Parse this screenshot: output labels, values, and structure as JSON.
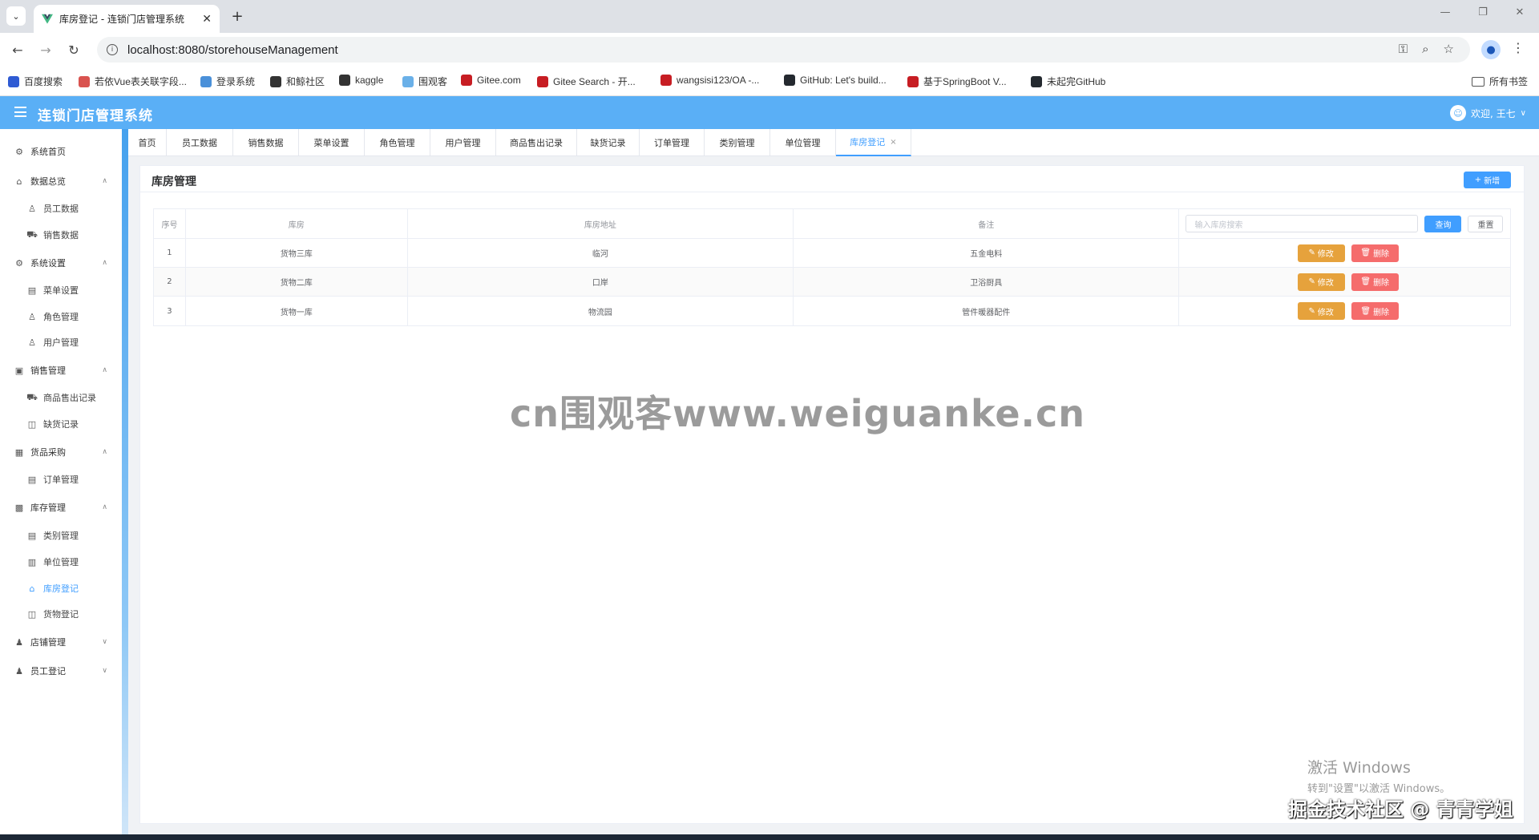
{
  "browser": {
    "tab_title": "库房登记 - 连锁门店管理系统",
    "url": "localhost:8080/storehouseManagement",
    "bookmarks": [
      {
        "label": "百度搜索",
        "color": "#2f5bd3"
      },
      {
        "label": "若依Vue表关联字段...",
        "color": "#d9534f"
      },
      {
        "label": "登录系统",
        "color": "#4a90d9"
      },
      {
        "label": "和鲸社区",
        "color": "#333333"
      },
      {
        "label": "kaggle",
        "color": "#333333"
      },
      {
        "label": "围观客",
        "color": "#6ab0e8"
      },
      {
        "label": "Gitee.com",
        "color": "#c71d23"
      },
      {
        "label": "Gitee Search - 开...",
        "color": "#c71d23"
      },
      {
        "label": "wangsisi123/OA -...",
        "color": "#c71d23"
      },
      {
        "label": "GitHub: Let's build...",
        "color": "#24292f"
      },
      {
        "label": "基于SpringBoot V...",
        "color": "#c71d23"
      },
      {
        "label": "未起完GitHub",
        "color": "#24292f"
      }
    ],
    "all_bookmarks": "所有书签"
  },
  "header": {
    "title": "连锁门店管理系统",
    "user": "欢迎, 王七"
  },
  "sidebar": {
    "items": [
      {
        "label": "系统首页",
        "type": "top",
        "icon": "settings-icon"
      },
      {
        "label": "数据总览",
        "type": "top",
        "icon": "home-icon",
        "chevron": "up"
      },
      {
        "label": "员工数据",
        "type": "sub",
        "icon": "user-icon"
      },
      {
        "label": "销售数据",
        "type": "sub",
        "icon": "truck-icon"
      },
      {
        "label": "系统设置",
        "type": "top",
        "icon": "gear-icon",
        "chevron": "up"
      },
      {
        "label": "菜单设置",
        "type": "sub",
        "icon": "document-icon"
      },
      {
        "label": "角色管理",
        "type": "sub",
        "icon": "user-icon"
      },
      {
        "label": "用户管理",
        "type": "sub",
        "icon": "user-icon"
      },
      {
        "label": "销售管理",
        "type": "top",
        "icon": "picture-icon",
        "chevron": "up"
      },
      {
        "label": "商品售出记录",
        "type": "sub",
        "icon": "truck-icon"
      },
      {
        "label": "缺货记录",
        "type": "sub",
        "icon": "bag-icon"
      },
      {
        "label": "货品采购",
        "type": "top",
        "icon": "lock-icon",
        "chevron": "up"
      },
      {
        "label": "订单管理",
        "type": "sub",
        "icon": "document-icon"
      },
      {
        "label": "库存管理",
        "type": "top",
        "icon": "briefcase-icon",
        "chevron": "up"
      },
      {
        "label": "类别管理",
        "type": "sub",
        "icon": "document-icon"
      },
      {
        "label": "单位管理",
        "type": "sub",
        "icon": "office-icon"
      },
      {
        "label": "库房登记",
        "type": "sub",
        "icon": "house-icon",
        "active": true
      },
      {
        "label": "货物登记",
        "type": "sub",
        "icon": "bag-icon"
      },
      {
        "label": "店铺管理",
        "type": "top",
        "icon": "person-icon",
        "chevron": "down"
      },
      {
        "label": "员工登记",
        "type": "top",
        "icon": "person-icon",
        "chevron": "down"
      }
    ]
  },
  "tags": [
    {
      "label": "首页"
    },
    {
      "label": "员工数据"
    },
    {
      "label": "销售数据"
    },
    {
      "label": "菜单设置"
    },
    {
      "label": "角色管理"
    },
    {
      "label": "用户管理"
    },
    {
      "label": "商品售出记录"
    },
    {
      "label": "缺货记录"
    },
    {
      "label": "订单管理"
    },
    {
      "label": "类别管理"
    },
    {
      "label": "单位管理"
    },
    {
      "label": "库房登记",
      "active": true
    }
  ],
  "page": {
    "title": "库房管理",
    "add_label": "新增",
    "search_placeholder": "输入库房搜索",
    "query_label": "查询",
    "reset_label": "重置",
    "columns": [
      "序号",
      "库房",
      "库房地址",
      "备注"
    ],
    "rows": [
      {
        "index": "1",
        "name": "货物三库",
        "address": "临河",
        "remark": "五金电料"
      },
      {
        "index": "2",
        "name": "货物二库",
        "address": "口岸",
        "remark": "卫浴厨具"
      },
      {
        "index": "3",
        "name": "货物一库",
        "address": "物流园",
        "remark": "管件暖器配件"
      }
    ],
    "edit_label": "修改",
    "delete_label": "删除"
  },
  "overlays": {
    "watermark": "cn围观客www.weiguanke.cn",
    "activate_line1": "激活 Windows",
    "activate_line2": "转到\"设置\"以激活 Windows。",
    "credit": "掘金技术社区 @ 青青学姐"
  },
  "colors": {
    "header_blue": "#5aaff6",
    "primary": "#409eff",
    "warning": "#e6a23c",
    "danger": "#f56c6c"
  }
}
